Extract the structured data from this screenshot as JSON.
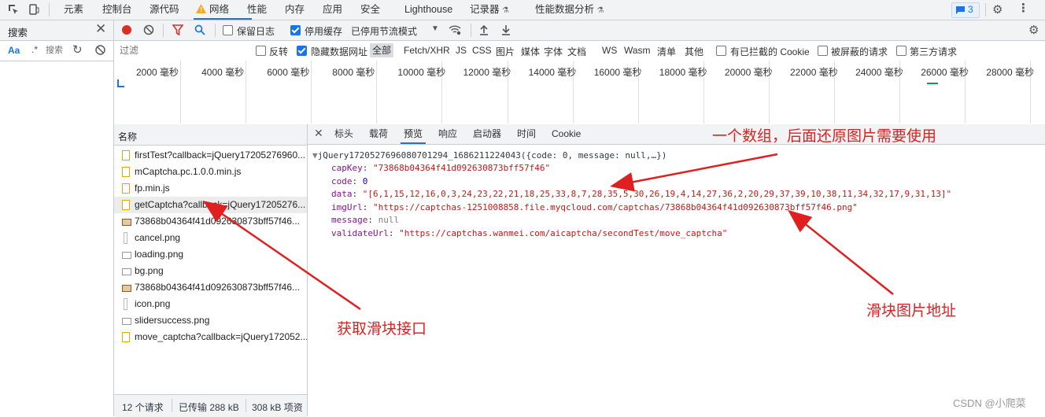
{
  "toptabs": {
    "elements": "元素",
    "console": "控制台",
    "sources": "源代码",
    "network": "网络",
    "performance": "性能",
    "memory": "内存",
    "application": "应用",
    "security": "安全",
    "lighthouse": "Lighthouse",
    "recorder": "记录器",
    "perf_insights": "性能数据分析",
    "issues_badge": "3"
  },
  "search_panel": {
    "title": "搜索",
    "aa": "Aa",
    "regex": ".*",
    "search_placeholder": "搜索"
  },
  "toolbar": {
    "preserve_log": "保留日志",
    "disable_cache": "停用缓存",
    "throttle": "已停用节流模式"
  },
  "filterbar": {
    "filter_placeholder": "过滤",
    "invert": "反转",
    "hide_data_urls": "隐藏数据网址",
    "types": [
      "全部",
      "Fetch/XHR",
      "JS",
      "CSS",
      "图片",
      "媒体",
      "字体",
      "文档",
      "WS",
      "Wasm",
      "清单",
      "其他"
    ],
    "blocked_cookies": "有已拦截的 Cookie",
    "blocked_requests": "被屏蔽的请求",
    "third_party": "第三方请求"
  },
  "overview": {
    "ticks": [
      "2000 毫秒",
      "4000 毫秒",
      "6000 毫秒",
      "8000 毫秒",
      "10000 毫秒",
      "12000 毫秒",
      "14000 毫秒",
      "16000 毫秒",
      "18000 毫秒",
      "20000 毫秒",
      "22000 毫秒",
      "24000 毫秒",
      "26000 毫秒",
      "28000 毫秒"
    ]
  },
  "requests": {
    "header": "名称",
    "items": [
      {
        "name": "firstTest?callback=jQuery17205276960...",
        "icon": "js-file-icon"
      },
      {
        "name": "mCaptcha.pc.1.0.0.min.js",
        "icon": "js-file-icon"
      },
      {
        "name": "fp.min.js",
        "icon": "js-file-icon"
      },
      {
        "name": "getCaptcha?callback=jQuery17205276...",
        "icon": "js-file-icon"
      },
      {
        "name": "73868b04364f41d092630873bff57f46...",
        "icon": "image-icon"
      },
      {
        "name": "cancel.png",
        "icon": "image-icon"
      },
      {
        "name": "loading.png",
        "icon": "image-icon"
      },
      {
        "name": "bg.png",
        "icon": "image-icon"
      },
      {
        "name": "73868b04364f41d092630873bff57f46...",
        "icon": "image-icon"
      },
      {
        "name": "icon.png",
        "icon": "image-icon"
      },
      {
        "name": "slidersuccess.png",
        "icon": "image-icon"
      },
      {
        "name": "move_captcha?callback=jQuery172052...",
        "icon": "js-file-icon"
      }
    ],
    "status": {
      "count": "12 个请求",
      "transferred": "已传输 288 kB",
      "resources": "308 kB 项资"
    }
  },
  "preview": {
    "tabs": [
      "标头",
      "载荷",
      "预览",
      "响应",
      "启动器",
      "时间",
      "Cookie"
    ],
    "root": "jQuery17205276960807012​94_1686211224043({code: 0, message: null,…})",
    "fields": [
      {
        "key": "capKey",
        "value": "\"73868b04364f41d092630873bff57f46\"",
        "kind": "string"
      },
      {
        "key": "code",
        "value": "0",
        "kind": "number"
      },
      {
        "key": "data",
        "value": "\"[6,1,15,12,16,0,3,24,23,22,21,18,25,33,8,7,28,35,5,30,26,19,4,14,27,36,2,20,29,37,39,10,38,11,34,32,17,9,31,13]\"",
        "kind": "string"
      },
      {
        "key": "imgUrl",
        "value": "\"https://captchas-1251008858.file.myqcloud.com/captchas/73868b04364f41d092630873bff57f46.png\"",
        "kind": "string"
      },
      {
        "key": "message",
        "value": "null",
        "kind": "null"
      },
      {
        "key": "validateUrl",
        "value": "\"https://captchas.wanmei.com/aicaptcha/secondTest/move_captcha\"",
        "kind": "string"
      }
    ]
  },
  "annotations": {
    "array_note": "一个数组，后面还原图片需要使用",
    "slider_img": "滑块图片地址",
    "slider_api": "获取滑块接口"
  },
  "watermark": "CSDN @小爬菜"
}
